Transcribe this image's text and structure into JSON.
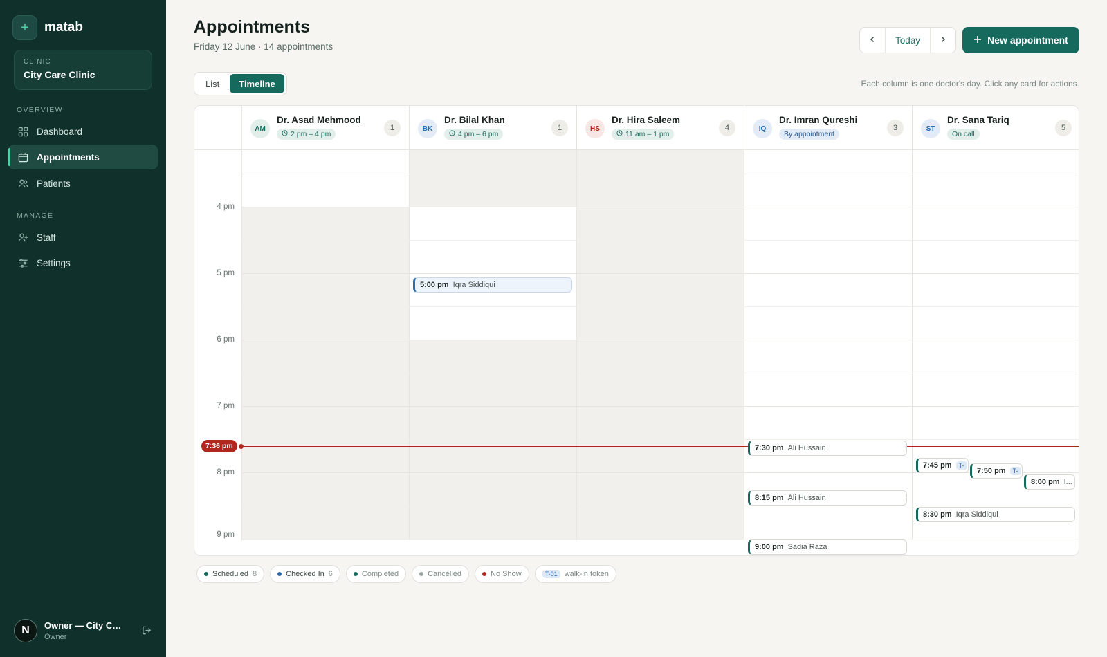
{
  "brand": {
    "name": "matab",
    "logo_icon": "plus-icon"
  },
  "clinic": {
    "label": "CLINIC",
    "name": "City Care Clinic"
  },
  "nav": {
    "overview_label": "OVERVIEW",
    "manage_label": "MANAGE",
    "items": [
      {
        "label": "Dashboard",
        "icon": "grid-icon"
      },
      {
        "label": "Appointments",
        "icon": "calendar-icon",
        "active": true
      },
      {
        "label": "Patients",
        "icon": "users-icon"
      },
      {
        "label": "Staff",
        "icon": "user-plus-icon"
      },
      {
        "label": "Settings",
        "icon": "sliders-icon"
      }
    ]
  },
  "user": {
    "initial": "N",
    "name": "Owner — City Care Clinic",
    "role": "Owner"
  },
  "header": {
    "title": "Appointments",
    "subtitle": "Friday 12 June · 14 appointments",
    "today_label": "Today",
    "new_label": "New appointment"
  },
  "view": {
    "list_label": "List",
    "timeline_label": "Timeline",
    "active": "Timeline"
  },
  "hint": "Each column is one doctor's day. Click any card for actions.",
  "doctors": [
    {
      "initials": "AM",
      "name": "Dr. Asad Mehmood",
      "hours": "2 pm – 4 pm",
      "count": "1"
    },
    {
      "initials": "BK",
      "name": "Dr. Bilal Khan",
      "hours": "4 pm – 6 pm",
      "count": "1"
    },
    {
      "initials": "HS",
      "name": "Dr. Hira Saleem",
      "hours": "11 am – 1 pm",
      "count": "4"
    },
    {
      "initials": "IQ",
      "name": "Dr. Imran Qureshi",
      "hours": "By appointment",
      "count": "3"
    },
    {
      "initials": "ST",
      "name": "Dr. Sana Tariq",
      "hours": "On call",
      "count": "5"
    }
  ],
  "hours": [
    "4 pm",
    "5 pm",
    "6 pm",
    "7 pm",
    "8 pm",
    "9 pm"
  ],
  "now": "7:36 pm",
  "appointments": [
    {
      "time": "5:00 pm",
      "patient": "Iqra Siddiqui",
      "status": "Checked In"
    },
    {
      "time": "7:30 pm",
      "patient": "Ali Hussain",
      "status": "Scheduled"
    },
    {
      "time": "8:15 pm",
      "patient": "Ali Hussain",
      "status": "Scheduled"
    },
    {
      "time": "9:00 pm",
      "patient": "Sadia Raza",
      "status": "Scheduled"
    },
    {
      "time": "7:45 pm",
      "patient": "",
      "token": "T-",
      "status": "Checked In"
    },
    {
      "time": "7:50 pm",
      "patient": "",
      "token": "T-",
      "status": "Checked In"
    },
    {
      "time": "8:00 pm",
      "patient": "I...",
      "status": "Scheduled"
    },
    {
      "time": "8:30 pm",
      "patient": "Iqra Siddiqui",
      "status": "Scheduled"
    }
  ],
  "legend": {
    "scheduled": {
      "label": "Scheduled",
      "count": "8",
      "color": "#16695d"
    },
    "checked_in": {
      "label": "Checked In",
      "count": "6",
      "color": "#2c6ab0"
    },
    "completed": {
      "label": "Completed",
      "color": "#16695d"
    },
    "cancelled": {
      "label": "Cancelled",
      "color": "#9aa4a0"
    },
    "no_show": {
      "label": "No Show",
      "color": "#b3261e"
    },
    "token": {
      "tag": "T-01",
      "label": "walk-in token"
    }
  }
}
